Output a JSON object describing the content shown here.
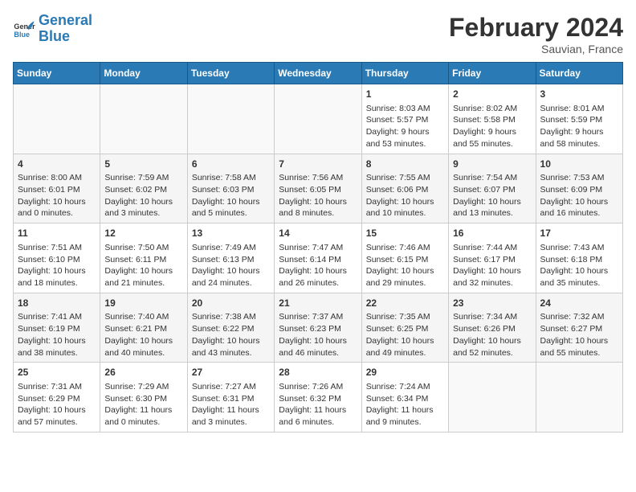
{
  "header": {
    "logo_general": "General",
    "logo_blue": "Blue",
    "month_title": "February 2024",
    "location": "Sauvian, France"
  },
  "days_of_week": [
    "Sunday",
    "Monday",
    "Tuesday",
    "Wednesday",
    "Thursday",
    "Friday",
    "Saturday"
  ],
  "weeks": [
    [
      {
        "day": "",
        "info": ""
      },
      {
        "day": "",
        "info": ""
      },
      {
        "day": "",
        "info": ""
      },
      {
        "day": "",
        "info": ""
      },
      {
        "day": "1",
        "info": "Sunrise: 8:03 AM\nSunset: 5:57 PM\nDaylight: 9 hours\nand 53 minutes."
      },
      {
        "day": "2",
        "info": "Sunrise: 8:02 AM\nSunset: 5:58 PM\nDaylight: 9 hours\nand 55 minutes."
      },
      {
        "day": "3",
        "info": "Sunrise: 8:01 AM\nSunset: 5:59 PM\nDaylight: 9 hours\nand 58 minutes."
      }
    ],
    [
      {
        "day": "4",
        "info": "Sunrise: 8:00 AM\nSunset: 6:01 PM\nDaylight: 10 hours\nand 0 minutes."
      },
      {
        "day": "5",
        "info": "Sunrise: 7:59 AM\nSunset: 6:02 PM\nDaylight: 10 hours\nand 3 minutes."
      },
      {
        "day": "6",
        "info": "Sunrise: 7:58 AM\nSunset: 6:03 PM\nDaylight: 10 hours\nand 5 minutes."
      },
      {
        "day": "7",
        "info": "Sunrise: 7:56 AM\nSunset: 6:05 PM\nDaylight: 10 hours\nand 8 minutes."
      },
      {
        "day": "8",
        "info": "Sunrise: 7:55 AM\nSunset: 6:06 PM\nDaylight: 10 hours\nand 10 minutes."
      },
      {
        "day": "9",
        "info": "Sunrise: 7:54 AM\nSunset: 6:07 PM\nDaylight: 10 hours\nand 13 minutes."
      },
      {
        "day": "10",
        "info": "Sunrise: 7:53 AM\nSunset: 6:09 PM\nDaylight: 10 hours\nand 16 minutes."
      }
    ],
    [
      {
        "day": "11",
        "info": "Sunrise: 7:51 AM\nSunset: 6:10 PM\nDaylight: 10 hours\nand 18 minutes."
      },
      {
        "day": "12",
        "info": "Sunrise: 7:50 AM\nSunset: 6:11 PM\nDaylight: 10 hours\nand 21 minutes."
      },
      {
        "day": "13",
        "info": "Sunrise: 7:49 AM\nSunset: 6:13 PM\nDaylight: 10 hours\nand 24 minutes."
      },
      {
        "day": "14",
        "info": "Sunrise: 7:47 AM\nSunset: 6:14 PM\nDaylight: 10 hours\nand 26 minutes."
      },
      {
        "day": "15",
        "info": "Sunrise: 7:46 AM\nSunset: 6:15 PM\nDaylight: 10 hours\nand 29 minutes."
      },
      {
        "day": "16",
        "info": "Sunrise: 7:44 AM\nSunset: 6:17 PM\nDaylight: 10 hours\nand 32 minutes."
      },
      {
        "day": "17",
        "info": "Sunrise: 7:43 AM\nSunset: 6:18 PM\nDaylight: 10 hours\nand 35 minutes."
      }
    ],
    [
      {
        "day": "18",
        "info": "Sunrise: 7:41 AM\nSunset: 6:19 PM\nDaylight: 10 hours\nand 38 minutes."
      },
      {
        "day": "19",
        "info": "Sunrise: 7:40 AM\nSunset: 6:21 PM\nDaylight: 10 hours\nand 40 minutes."
      },
      {
        "day": "20",
        "info": "Sunrise: 7:38 AM\nSunset: 6:22 PM\nDaylight: 10 hours\nand 43 minutes."
      },
      {
        "day": "21",
        "info": "Sunrise: 7:37 AM\nSunset: 6:23 PM\nDaylight: 10 hours\nand 46 minutes."
      },
      {
        "day": "22",
        "info": "Sunrise: 7:35 AM\nSunset: 6:25 PM\nDaylight: 10 hours\nand 49 minutes."
      },
      {
        "day": "23",
        "info": "Sunrise: 7:34 AM\nSunset: 6:26 PM\nDaylight: 10 hours\nand 52 minutes."
      },
      {
        "day": "24",
        "info": "Sunrise: 7:32 AM\nSunset: 6:27 PM\nDaylight: 10 hours\nand 55 minutes."
      }
    ],
    [
      {
        "day": "25",
        "info": "Sunrise: 7:31 AM\nSunset: 6:29 PM\nDaylight: 10 hours\nand 57 minutes."
      },
      {
        "day": "26",
        "info": "Sunrise: 7:29 AM\nSunset: 6:30 PM\nDaylight: 11 hours\nand 0 minutes."
      },
      {
        "day": "27",
        "info": "Sunrise: 7:27 AM\nSunset: 6:31 PM\nDaylight: 11 hours\nand 3 minutes."
      },
      {
        "day": "28",
        "info": "Sunrise: 7:26 AM\nSunset: 6:32 PM\nDaylight: 11 hours\nand 6 minutes."
      },
      {
        "day": "29",
        "info": "Sunrise: 7:24 AM\nSunset: 6:34 PM\nDaylight: 11 hours\nand 9 minutes."
      },
      {
        "day": "",
        "info": ""
      },
      {
        "day": "",
        "info": ""
      }
    ]
  ]
}
